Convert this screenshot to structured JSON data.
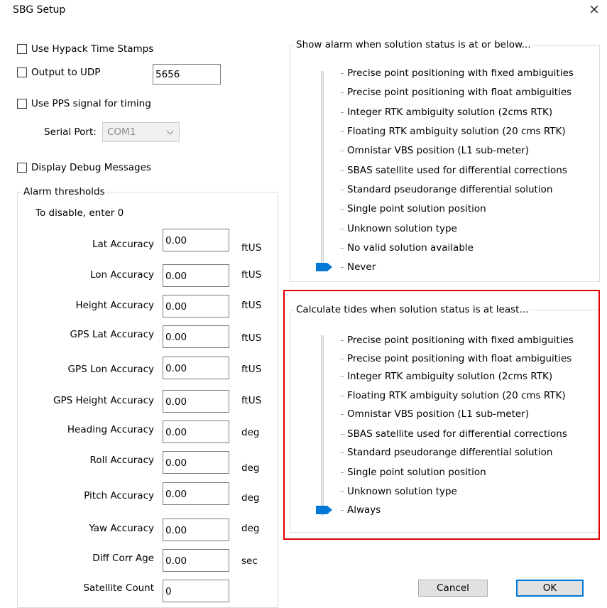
{
  "window": {
    "title": "SBG Setup",
    "close_glyph": "×"
  },
  "options": {
    "use_hypack_time_stamps": {
      "label": "Use Hypack Time Stamps",
      "checked": false
    },
    "output_to_udp": {
      "label": "Output to UDP",
      "checked": false,
      "port": "5656"
    },
    "use_pps": {
      "label": "Use PPS signal for timing",
      "checked": false
    },
    "serial_port": {
      "label": "Serial Port:",
      "value": "COM1",
      "enabled": false
    },
    "display_debug": {
      "label": "Display Debug Messages",
      "checked": false
    }
  },
  "alarm_thresholds": {
    "title": "Alarm thresholds",
    "note": "To disable, enter 0",
    "rows": [
      {
        "label": "Lat Accuracy",
        "value": "0.00",
        "unit": "ftUS"
      },
      {
        "label": "Lon Accuracy",
        "value": "0.00",
        "unit": "ftUS"
      },
      {
        "label": "Height Accuracy",
        "value": "0.00",
        "unit": "ftUS"
      },
      {
        "label": "GPS Lat Accuracy",
        "value": "0.00",
        "unit": "ftUS"
      },
      {
        "label": "GPS Lon Accuracy",
        "value": "0.00",
        "unit": "ftUS"
      },
      {
        "label": "GPS Height Accuracy",
        "value": "0.00",
        "unit": "ftUS"
      },
      {
        "label": "Heading Accuracy",
        "value": "0.00",
        "unit": "deg"
      },
      {
        "label": "Roll Accuracy",
        "value": "0.00",
        "unit": "deg"
      },
      {
        "label": "Pitch Accuracy",
        "value": "0.00",
        "unit": "deg"
      },
      {
        "label": "Yaw Accuracy",
        "value": "0.00",
        "unit": "deg"
      },
      {
        "label": "Diff Corr Age",
        "value": "0.00",
        "unit": "sec"
      },
      {
        "label": "Satellite Count",
        "value": "0",
        "unit": ""
      }
    ]
  },
  "alarm_status": {
    "title": "Show alarm when solution status is at or below...",
    "options": [
      "Precise point positioning with fixed ambiguities",
      "Precise point positioning with float ambiguities",
      "Integer RTK ambiguity solution (2cms RTK)",
      "Floating RTK ambiguity solution (20 cms RTK)",
      "Omnistar VBS position (L1 sub-meter)",
      "SBAS satellite used for differential corrections",
      "Standard pseudorange differential solution",
      "Single point solution position",
      "Unknown solution type",
      "No valid solution available",
      "Never"
    ],
    "selected": "Never"
  },
  "tide_status": {
    "title": "Calculate tides when solution status is at least...",
    "options": [
      "Precise point positioning with fixed ambiguities",
      "Precise point positioning with float ambiguities",
      "Integer RTK ambiguity solution (2cms RTK)",
      "Floating RTK ambiguity solution (20 cms RTK)",
      "Omnistar VBS position (L1 sub-meter)",
      "SBAS satellite used for differential corrections",
      "Standard pseudorange differential solution",
      "Single point solution position",
      "Unknown solution type",
      "Always"
    ],
    "selected": "Always"
  },
  "buttons": {
    "cancel": "Cancel",
    "ok": "OK"
  },
  "colors": {
    "slider_thumb": "#0078d7",
    "highlight_box": "#e00000",
    "default_button_border": "#0078d7"
  }
}
